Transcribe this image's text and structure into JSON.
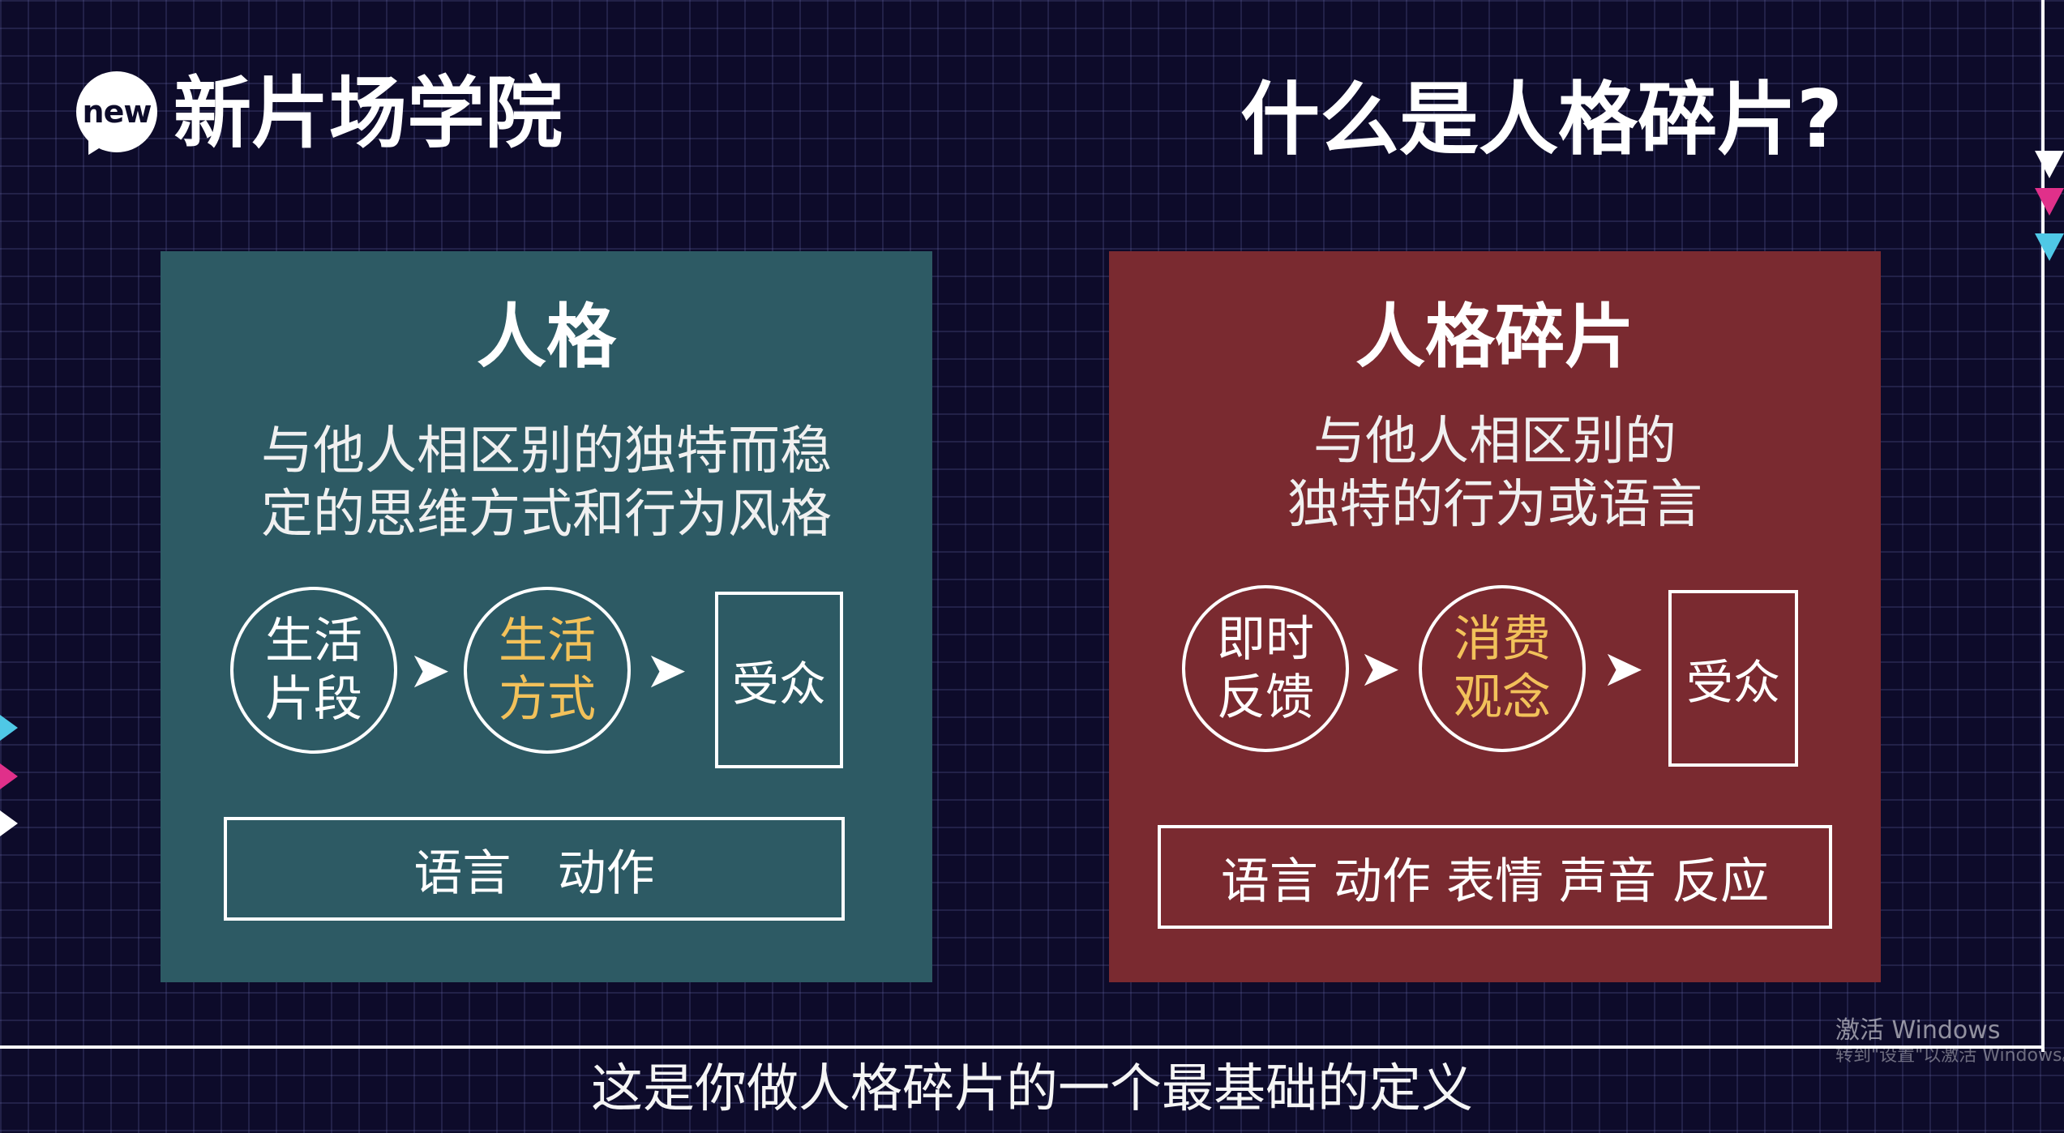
{
  "header": {
    "logo_text": "new",
    "brand_name": "新片场学院",
    "page_title": "什么是人格碎片?"
  },
  "left_panel": {
    "title": "人格",
    "description_line1": "与他人相区别的独特而稳",
    "description_line2": "定的思维方式和行为风格",
    "circle1_line1": "生活",
    "circle1_line2": "片段",
    "circle2_line1": "生活",
    "circle2_line2": "方式",
    "audience": "受众",
    "bar_text": "语言   动作"
  },
  "right_panel": {
    "title": "人格碎片",
    "description_line1": "与他人相区别的",
    "description_line2": "独特的行为或语言",
    "circle1_line1": "即时",
    "circle1_line2": "反馈",
    "circle2_line1": "消费",
    "circle2_line2": "观念",
    "audience": "受众",
    "bar_text": "语言 动作 表情 声音 反应"
  },
  "subtitle": "这是你做人格碎片的一个最基础的定义",
  "watermark": {
    "line1": "激活 Windows",
    "line2": "转到\"设置\"以激活 Windows。"
  },
  "colors": {
    "background": "#0d0b2a",
    "left_panel": "#2d5a64",
    "right_panel": "#7a2a30",
    "highlight_text": "#f2c15a",
    "accent_pink": "#e0308a",
    "accent_cyan": "#4fc8e6"
  },
  "icons": {
    "arrow": "chevron-right-icon",
    "logo": "speech-bubble-icon"
  }
}
